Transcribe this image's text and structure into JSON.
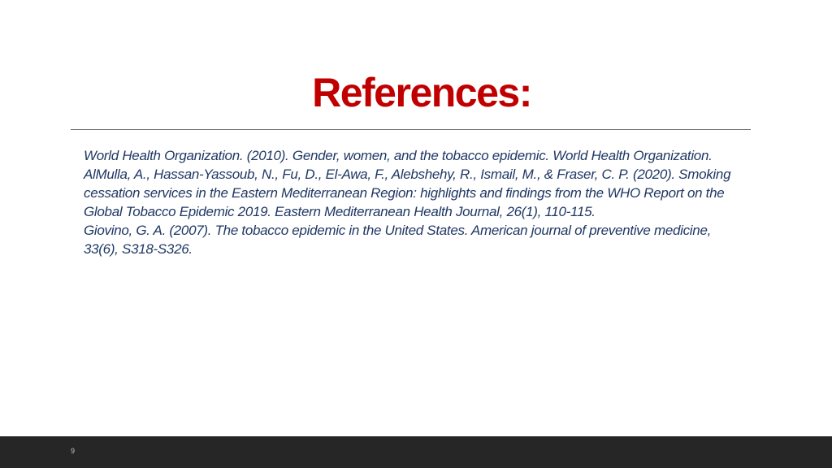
{
  "slide": {
    "title": "References:",
    "references": [
      "World Health Organization. (2010). Gender, women, and the tobacco epidemic. World Health Organization.",
      "AlMulla, A., Hassan-Yassoub, N., Fu, D., El-Awa, F., Alebshehy, R., Ismail, M., & Fraser, C. P. (2020). Smoking cessation services in the Eastern Mediterranean Region: highlights and findings from the WHO Report on the Global Tobacco Epidemic 2019. Eastern Mediterranean Health Journal, 26(1), 110-115.",
      "Giovino, G. A. (2007). The tobacco epidemic in the United States. American journal of preventive medicine, 33(6), S318-S326."
    ],
    "page_number": "9"
  },
  "colors": {
    "title": "#c00000",
    "body_text": "#1f3864",
    "footer_bar": "#262626"
  }
}
